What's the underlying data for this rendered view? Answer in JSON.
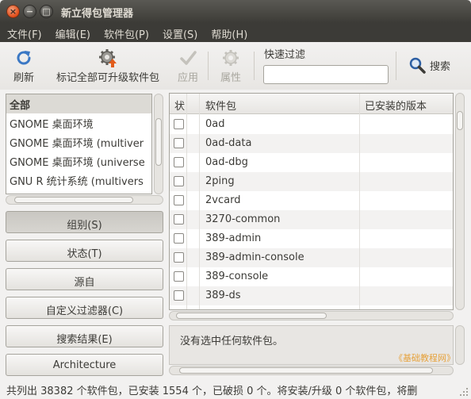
{
  "window": {
    "title": "新立得包管理器",
    "close_glyph": "×",
    "minimize_glyph": "−",
    "maximize_glyph": "□"
  },
  "menubar": [
    {
      "label": "文件(F)"
    },
    {
      "label": "编辑(E)"
    },
    {
      "label": "软件包(P)"
    },
    {
      "label": "设置(S)"
    },
    {
      "label": "帮助(H)"
    }
  ],
  "toolbar": {
    "refresh": {
      "label": "刷新",
      "icon": "refresh-icon"
    },
    "mark_all_upgrades": {
      "label": "标记全部可升级软件包",
      "icon": "upgrade-gear-icon"
    },
    "apply": {
      "label": "应用",
      "icon": "check-icon",
      "enabled": false
    },
    "properties": {
      "label": "属性",
      "icon": "gear-icon",
      "enabled": false
    },
    "quick_filter": {
      "label": "快速过滤",
      "value": "",
      "placeholder": ""
    },
    "search": {
      "label": "搜索",
      "icon": "magnifier-icon"
    }
  },
  "categories": {
    "items": [
      {
        "label": "全部",
        "selected": true
      },
      {
        "label": "GNOME 桌面环境",
        "selected": false
      },
      {
        "label": "GNOME 桌面环境 (multiver",
        "selected": false
      },
      {
        "label": "GNOME 桌面环境 (universe",
        "selected": false
      },
      {
        "label": "GNU R 统计系统 (multivers",
        "selected": false
      }
    ]
  },
  "filter_buttons": [
    {
      "label": "组别(S)",
      "pressed": true
    },
    {
      "label": "状态(T)",
      "pressed": false
    },
    {
      "label": "源自",
      "pressed": false
    },
    {
      "label": "自定义过滤器(C)",
      "pressed": false
    },
    {
      "label": "搜索结果(E)",
      "pressed": false
    },
    {
      "label": "Architecture",
      "pressed": false
    }
  ],
  "package_table": {
    "columns": {
      "status": "状",
      "package": "软件包",
      "installed_version": "已安装的版本"
    },
    "rows": [
      {
        "name": "0ad",
        "checked": false
      },
      {
        "name": "0ad-data",
        "checked": false
      },
      {
        "name": "0ad-dbg",
        "checked": false
      },
      {
        "name": "2ping",
        "checked": false
      },
      {
        "name": "2vcard",
        "checked": false
      },
      {
        "name": "3270-common",
        "checked": false
      },
      {
        "name": "389-admin",
        "checked": false
      },
      {
        "name": "389-admin-console",
        "checked": false
      },
      {
        "name": "389-console",
        "checked": false
      },
      {
        "name": "389-ds",
        "checked": false
      }
    ]
  },
  "description": {
    "text": "没有选中任何软件包。",
    "watermark": "《基础教程网》"
  },
  "statusbar": {
    "text": "共列出 38382 个软件包，已安装 1554 个，已破损 0 个。将安装/升级 0 个软件包，将删"
  },
  "colors": {
    "titlebar": "#3c3b37",
    "close_button": "#df4a16",
    "window_bg": "#f2f1f0",
    "watermark": "#e6a23c"
  }
}
